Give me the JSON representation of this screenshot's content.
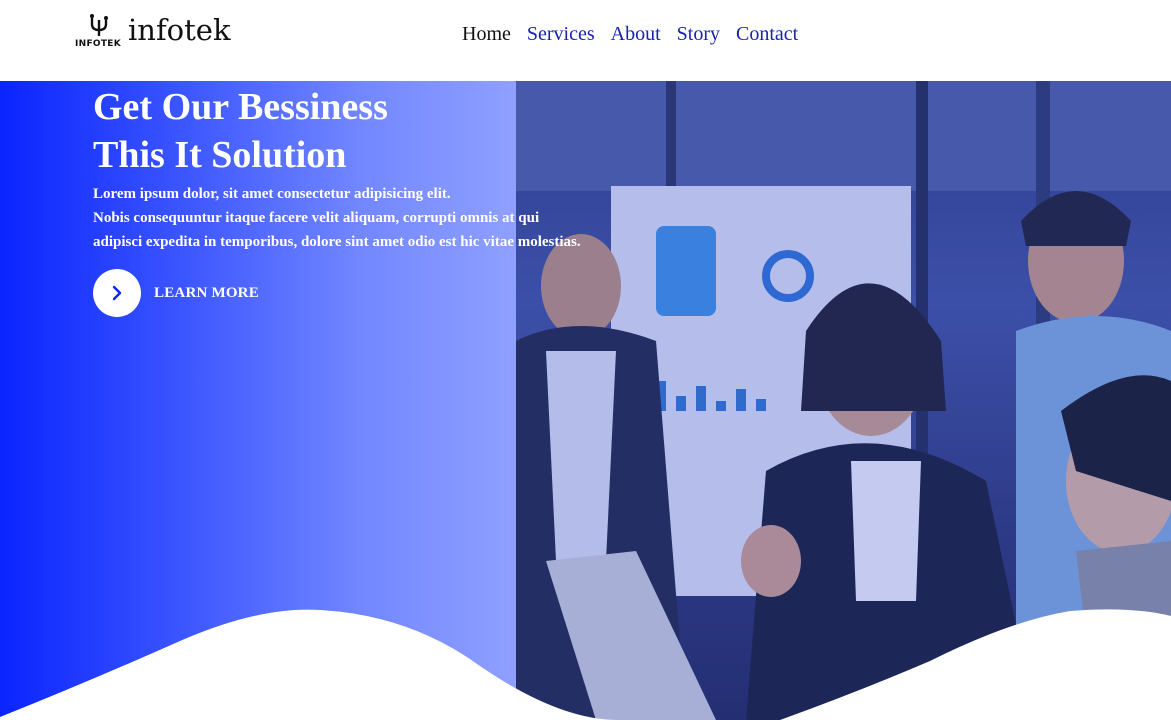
{
  "header": {
    "logo_text": "INFOTEK",
    "brand": "infotek",
    "nav": [
      {
        "label": "Home",
        "active": true
      },
      {
        "label": "Services",
        "active": false
      },
      {
        "label": "About",
        "active": false
      },
      {
        "label": "Story",
        "active": false
      },
      {
        "label": "Contact",
        "active": false
      }
    ]
  },
  "hero": {
    "title_line1": "Get Our Bessiness",
    "title_line2": "This It Solution",
    "text_line1": "Lorem ipsum dolor, sit amet consectetur adipisicing elit.",
    "text_line2": "Nobis consequuntur itaque facere velit aliquam, corrupti omnis at qui",
    "text_line3": "adipisci expedita in temporibus, dolore sint amet odio est hic vitae molestias.",
    "cta_label": "LEARN MORE",
    "cta_icon": "chevron-right-icon",
    "photo_subject": "team-meeting-photo"
  },
  "colors": {
    "accent": "#0a24ff",
    "nav_link": "#1a22b0",
    "nav_active": "#111111",
    "white": "#ffffff"
  }
}
